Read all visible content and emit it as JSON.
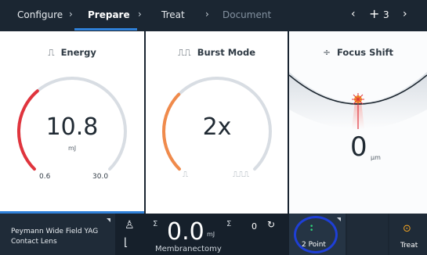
{
  "nav": {
    "steps": [
      "Configure",
      "Prepare",
      "Treat",
      "Document"
    ],
    "separator": "›",
    "prev_icon": "chevron-left-icon",
    "next_icon": "chevron-right-icon",
    "prev_glyph": "‹",
    "next_glyph": "›",
    "spot_icon": "crosshair-icon",
    "spot_glyph": "+",
    "spot_count": "3"
  },
  "energy": {
    "title": "Energy",
    "icon": "pulse-icon",
    "icon_glyph": "⎍",
    "value": "10.8",
    "unit": "mJ",
    "min": "0.6",
    "max": "30.0",
    "level": 0.35,
    "accent": "#e0343d"
  },
  "burst": {
    "title": "Burst Mode",
    "icon": "burst-pulse-icon",
    "icon_glyph": "⎍⎍",
    "value": "2x",
    "level": 0.33,
    "accent": "#f08a4b",
    "min_icon": "single-pulse-icon",
    "min_glyph": "⎍",
    "max_icon": "multi-pulse-icon",
    "max_glyph": "⎍⎍⎍"
  },
  "focus": {
    "title": "Focus Shift",
    "icon": "focus-shift-icon",
    "icon_glyph": "÷",
    "value": "0",
    "unit": "µm",
    "accent": "#e0343d"
  },
  "bottom": {
    "lens_line1": "Peymann Wide Field YAG",
    "lens_line2": "Contact Lens",
    "sigma": "Σ",
    "total_energy": "0.0",
    "total_unit": "mJ",
    "shot_count": "0",
    "procedure": "Membranectomy",
    "pattern_label": "2 Point",
    "treat_label": "Treat",
    "treat_glyph": "⊙",
    "reset_glyph": "↻",
    "person_glyph": "♙",
    "foot_glyph": "⌊",
    "dot_glyph": "•",
    "ring_color": "#1e3fd6",
    "dot_color": "#2fd37a"
  }
}
